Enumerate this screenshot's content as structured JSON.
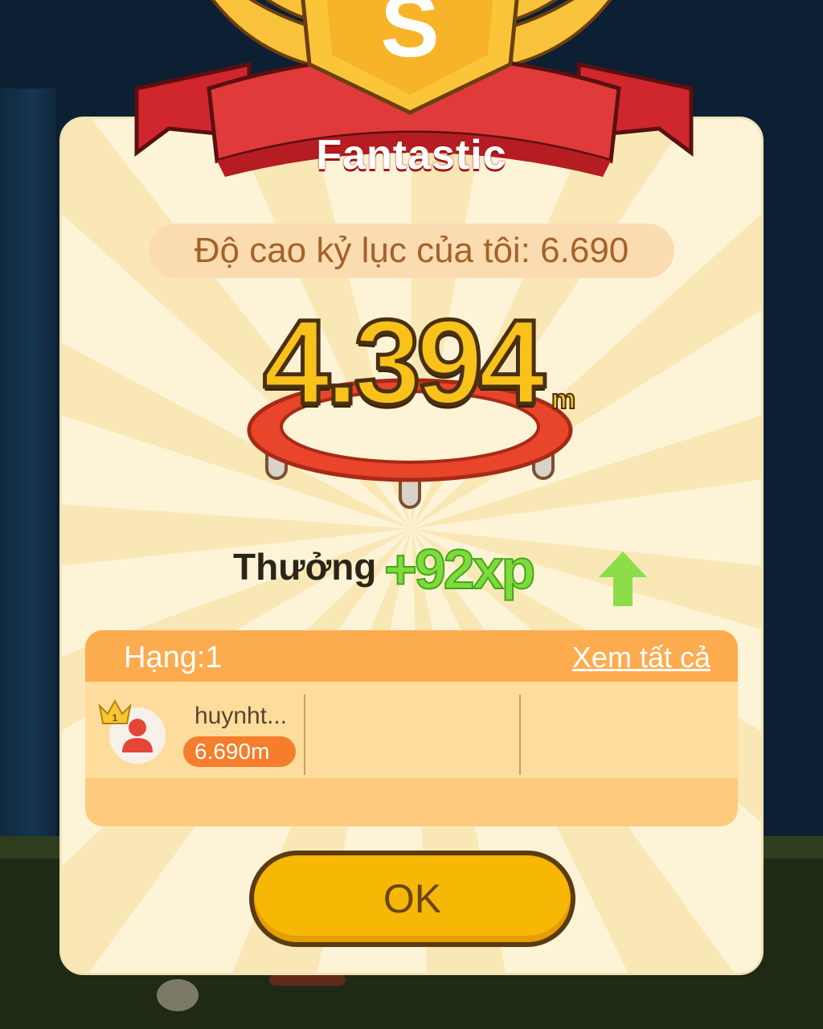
{
  "header": {
    "title": "Fantastic",
    "medal_letter": "S"
  },
  "record": {
    "text": "Độ cao kỷ lục của tôi: 6.690"
  },
  "score": {
    "value": "4.394",
    "unit": "m"
  },
  "reward": {
    "label": "Thưởng",
    "value": "+92xp",
    "trend_icon": "arrow-up-icon"
  },
  "ranking": {
    "title": "Hạng:1",
    "view_all": "Xem tất cả",
    "players": [
      {
        "name": "huynht...",
        "score": "6.690m",
        "rank": 1,
        "icon": "user-avatar-icon"
      }
    ]
  },
  "buttons": {
    "ok_label": "OK"
  },
  "colors": {
    "accent": "#f6b705",
    "score_fill": "#f8c21b",
    "reward_green": "#7ddc3c",
    "ribbon_red": "#d0262d",
    "rank_header": "#fdab4f"
  }
}
